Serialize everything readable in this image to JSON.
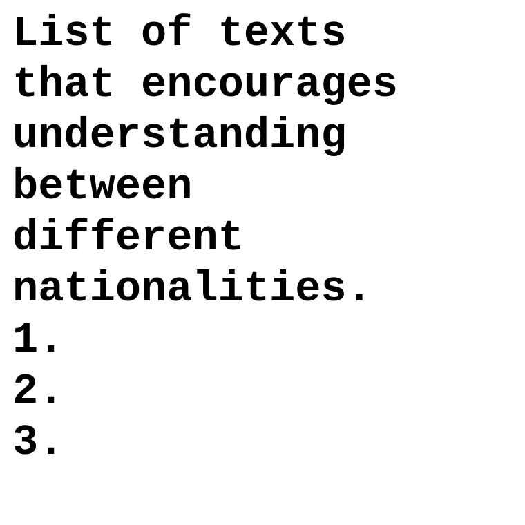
{
  "title_lines": [
    "List of texts",
    "that encourages",
    "understanding",
    "between",
    "different",
    "nationalities."
  ],
  "list_items": [
    "1.",
    "2.",
    "3."
  ]
}
